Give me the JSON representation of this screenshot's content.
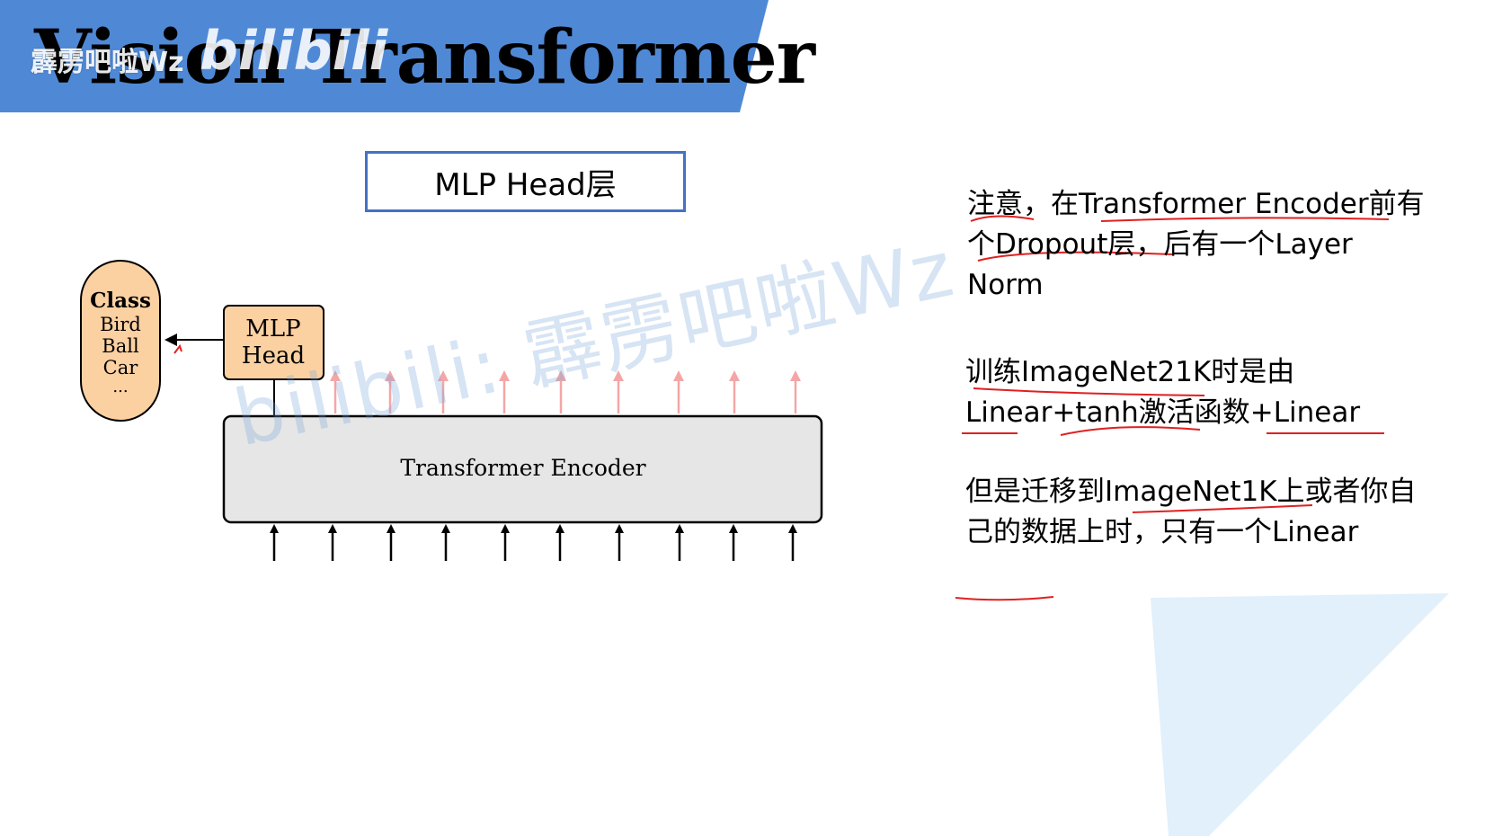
{
  "slide": {
    "title": "Vision Transformer",
    "watermark_top": "霹雳吧啦Wz",
    "watermark_logo": "bilibili",
    "watermark_diagonal": "bilibili: 霹雳吧啦Wz",
    "banner_color": "#4f89d6"
  },
  "mlp_head_label": "MLP Head层",
  "diagram": {
    "class_box": {
      "title": "Class",
      "items": [
        "Bird",
        "Ball",
        "Car",
        "..."
      ],
      "fill": "#fbd1a2"
    },
    "mlp_head": {
      "line1": "MLP",
      "line2": "Head",
      "fill": "#fbd1a2"
    },
    "encoder": {
      "label": "Transformer Encoder",
      "fill": "#e6e6e6"
    },
    "output_arrow_color": "#f4a6a6",
    "input_arrow_color": "#000000"
  },
  "notes": [
    "注意，在Transformer Encoder前有个Dropout层，后有一个Layer Norm",
    "训练ImageNet21K时是由Linear+tanh激活函数+Linear",
    "但是迁移到ImageNet1K上或者你自己的数据上时，只有一个Linear"
  ],
  "annotation_color": "#e02020"
}
